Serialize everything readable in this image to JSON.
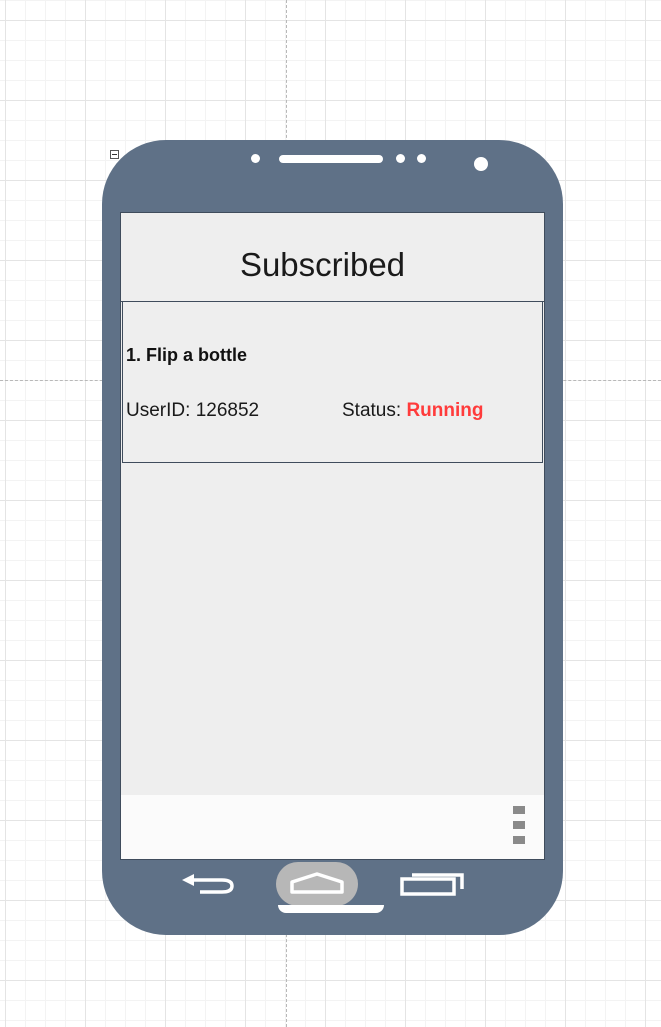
{
  "screen": {
    "title": "Subscribed"
  },
  "item": {
    "title": "1. Flip a bottle",
    "user_label": "UserID:",
    "user_id": "126852",
    "status_label": "Status:",
    "status_value": "Running",
    "status_color": "#ff3b3b"
  },
  "device": {
    "body_color": "#5f7187",
    "screen_color": "#eeeeee"
  },
  "icons": {
    "collapse": "minus-box-icon",
    "back": "back-arrow-icon",
    "home": "home-icon",
    "recent": "recent-apps-icon",
    "overflow": "overflow-menu-icon"
  }
}
